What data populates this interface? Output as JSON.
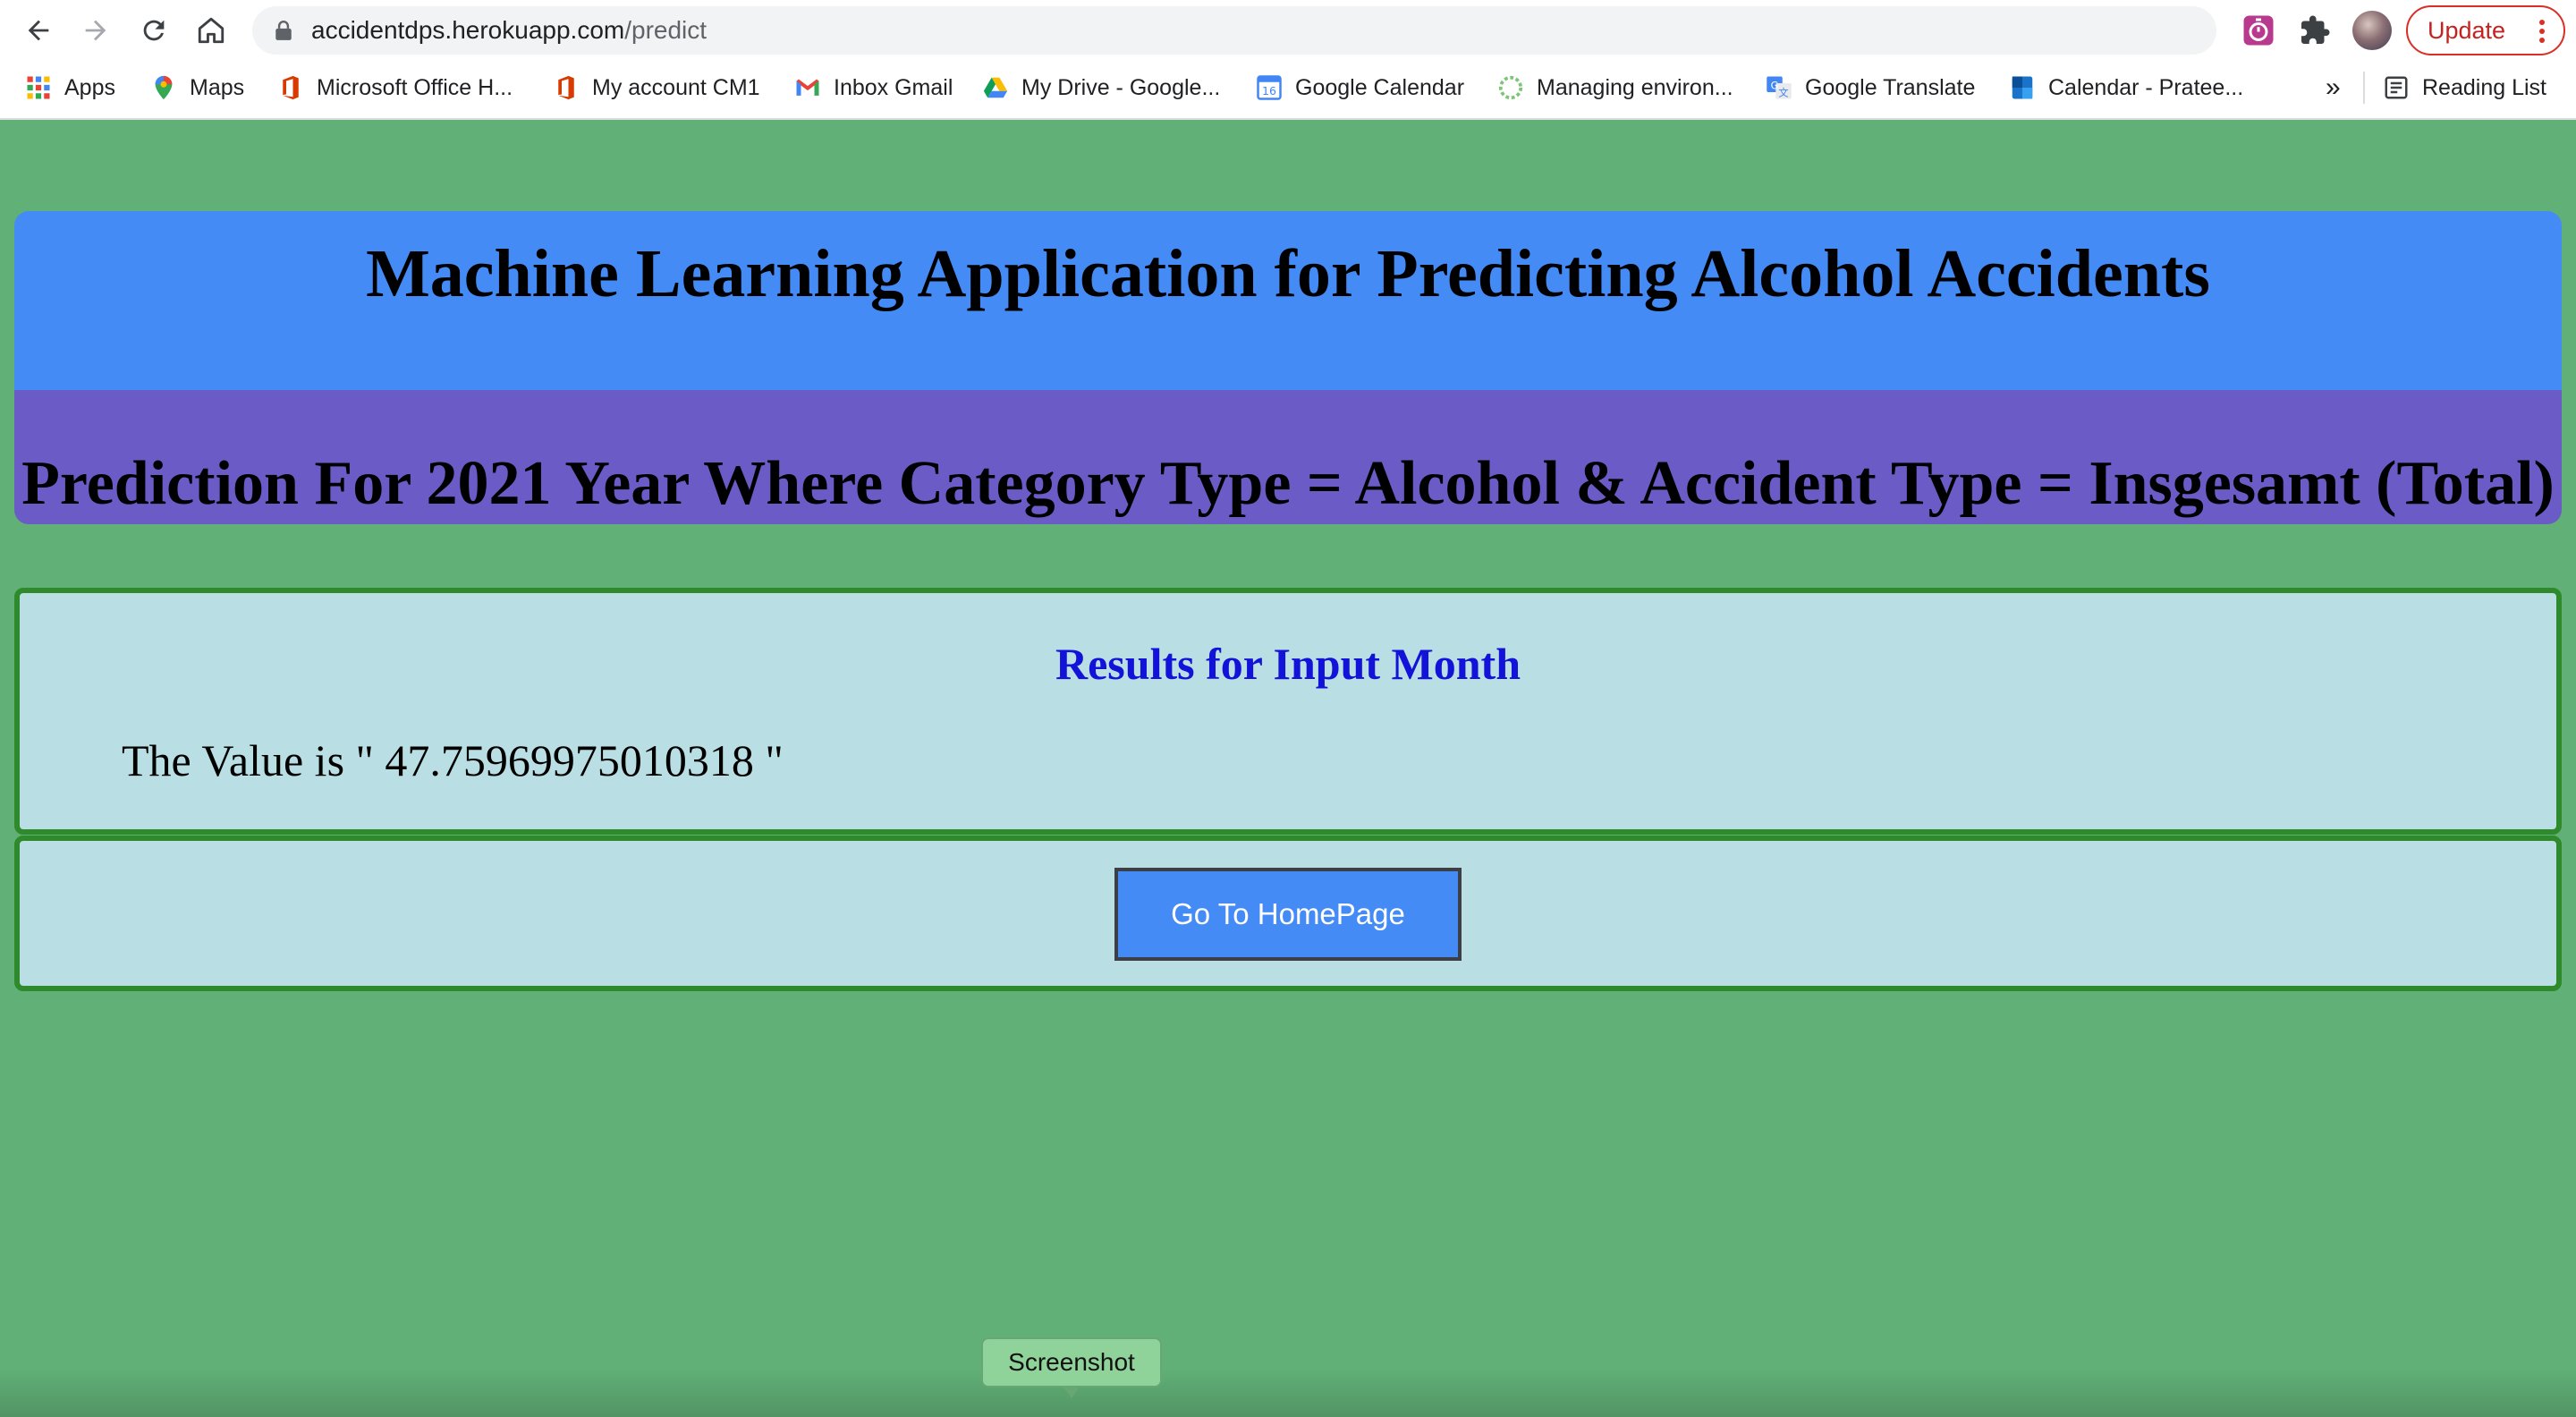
{
  "browser": {
    "url_host": "accidentdps.herokuapp.com",
    "url_path": "/predict",
    "update_label": "Update",
    "bookmarks": [
      {
        "label": "Apps",
        "icon": "apps-grid-icon"
      },
      {
        "label": "Maps",
        "icon": "maps-pin-icon"
      },
      {
        "label": "Microsoft Office H...",
        "icon": "office-icon"
      },
      {
        "label": "My account CM1",
        "icon": "office-icon"
      },
      {
        "label": "Inbox Gmail",
        "icon": "gmail-icon"
      },
      {
        "label": "My Drive - Google...",
        "icon": "drive-icon"
      },
      {
        "label": "Google Calendar",
        "icon": "calendar-icon"
      },
      {
        "label": "Managing environ...",
        "icon": "spinner-icon"
      },
      {
        "label": "Google Translate",
        "icon": "translate-icon"
      },
      {
        "label": "Calendar - Pratee...",
        "icon": "outlook-calendar-icon"
      }
    ],
    "more_bookmarks": "»",
    "reading_list": "Reading List",
    "colors": {
      "chrome_bg": "#ffffff",
      "omnibox_bg": "#f1f3f4",
      "update_red": "#d93025"
    }
  },
  "page": {
    "title": "Machine Learning Application for Predicting Alcohol Accidents",
    "subtitle": "Prediction For 2021 Year Where Category Type = Alcohol & Accident Type = Insgesamt (Total)",
    "results_heading": "Results for Input Month",
    "result_text": "The Value is \" 47.75969975010318 \"",
    "home_button": "Go To HomePage",
    "colors": {
      "background": "#61b077",
      "header_blue": "#448bf5",
      "header_purple": "#6a5bc6",
      "panel_bg": "#b9dfe4",
      "panel_border": "#2f8a2c",
      "heading_blue": "#1212d8"
    }
  },
  "tooltip": {
    "label": "Screenshot"
  }
}
